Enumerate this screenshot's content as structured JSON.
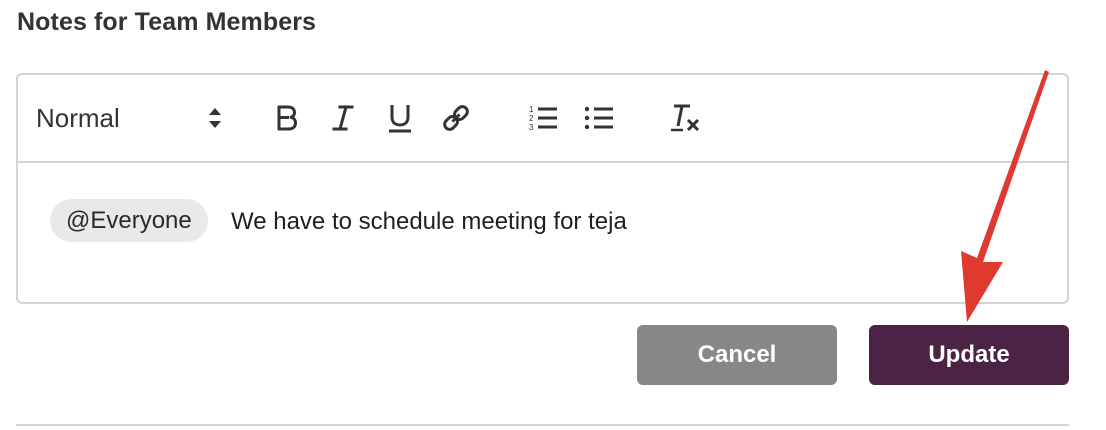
{
  "section": {
    "title": "Notes for Team Members"
  },
  "toolbar": {
    "format_select_value": "Normal",
    "buttons": [
      {
        "name": "bold",
        "icon": "bold-icon"
      },
      {
        "name": "italic",
        "icon": "italic-icon"
      },
      {
        "name": "underline",
        "icon": "underline-icon"
      },
      {
        "name": "link",
        "icon": "link-icon"
      },
      {
        "name": "ordered-list",
        "icon": "ordered-list-icon"
      },
      {
        "name": "bullet-list",
        "icon": "bullet-list-icon"
      },
      {
        "name": "clear-format",
        "icon": "clear-format-icon"
      }
    ]
  },
  "editor": {
    "mention": "@Everyone",
    "text": "We have to schedule meeting for teja"
  },
  "actions": {
    "cancel_label": "Cancel",
    "update_label": "Update"
  },
  "colors": {
    "update_button": "#4a2345",
    "cancel_button": "#878787",
    "annotation_arrow": "#e0392f",
    "mention_chip": "#e9e9ea"
  }
}
